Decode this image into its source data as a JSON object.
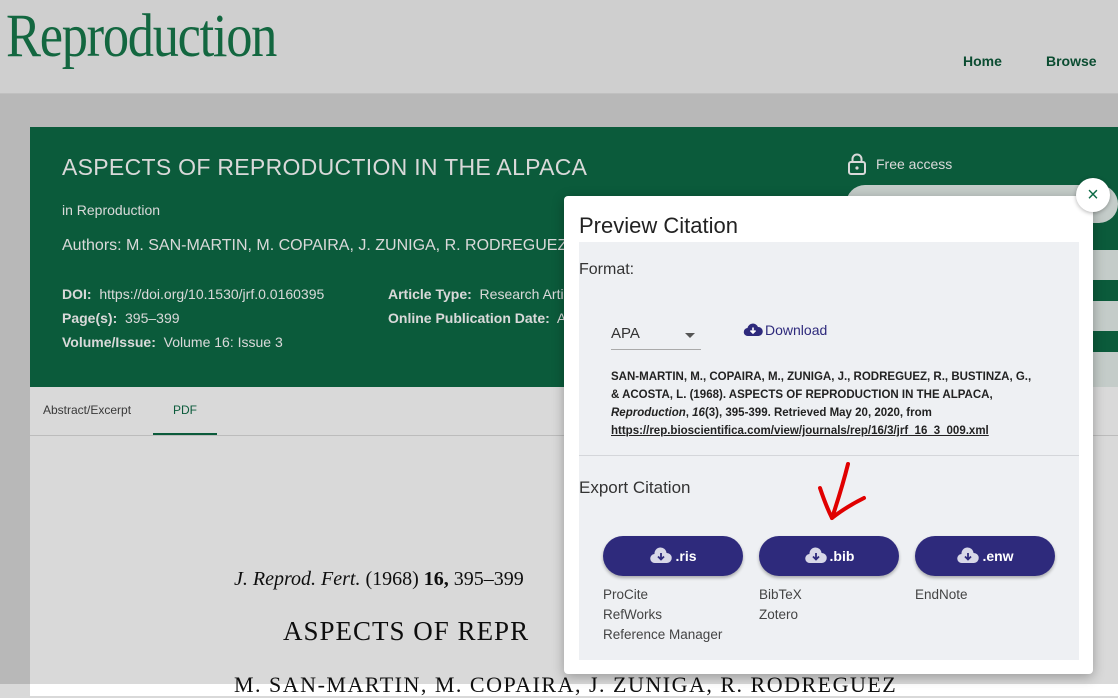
{
  "site": {
    "logo": "Reproduction",
    "nav": [
      "Home",
      "Browse"
    ]
  },
  "article": {
    "title": "ASPECTS OF REPRODUCTION IN THE ALPACA",
    "journal": "in Reproduction",
    "authors": "Authors: M. SAN-MARTIN, M. COPAIRA, J. ZUNIGA, R. RODREGUEZ",
    "doi_label": "DOI:",
    "doi": "https://doi.org/10.1530/jrf.0.0160395",
    "pages_label": "Page(s):",
    "pages": "395–399",
    "volume_label": "Volume/Issue:",
    "volume": "Volume 16: Issue 3",
    "type_label": "Article Type:",
    "type": "Research Arti",
    "pubdate_label": "Online Publication Date:",
    "pubdate": "A",
    "access": "Free access"
  },
  "tabs": [
    "Abstract/Excerpt",
    "PDF"
  ],
  "pdf": {
    "line1_prefix": "J. Reprod. Fert.",
    "line1_rest": " (1968) ",
    "line1_vol": "16,",
    "line1_pages": " 395–399",
    "heading": "ASPECTS OF REPR",
    "authors_partial": "M. SAN-MARTIN, M. COPAIRA, J. ZUNIGA, R. RODREGUEZ"
  },
  "modal": {
    "title": "Preview Citation",
    "format_label": "Format:",
    "format_value": "APA",
    "download_label": "Download",
    "citation_pre": "SAN-MARTIN, M., COPAIRA, M., ZUNIGA, J., RODREGUEZ, R., BUSTINZA, G., & ACOSTA, L. (1968). ASPECTS OF REPRODUCTION IN THE ALPACA,",
    "citation_journal": "Reproduction",
    "citation_sep": ", ",
    "citation_vol": "16",
    "citation_rest": "(3), 395-399. Retrieved May 20, 2020, from",
    "citation_url": "https://rep.bioscientifica.com/view/journals/rep/16/3/jrf_16_3_009.xml",
    "export_label": "Export Citation",
    "exports": [
      {
        "label": ".ris",
        "apps": [
          "ProCite",
          "RefWorks",
          "Reference Manager"
        ]
      },
      {
        "label": ".bib",
        "apps": [
          "BibTeX",
          "Zotero"
        ]
      },
      {
        "label": ".enw",
        "apps": [
          "EndNote"
        ]
      }
    ],
    "close": "×"
  },
  "colors": {
    "primary_green": "#0e6b46",
    "button_purple": "#2e2a7c",
    "annotation_red": "#e00000"
  }
}
